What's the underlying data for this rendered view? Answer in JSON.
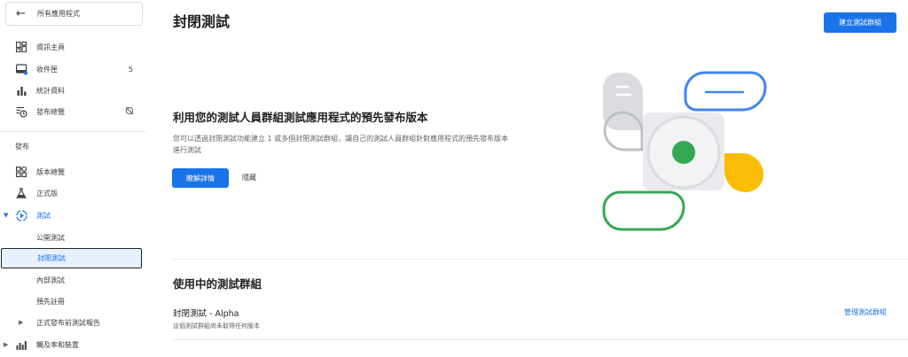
{
  "sidebar": {
    "back_label": "所有應用程式",
    "top_items": [
      {
        "label": "資訊主頁",
        "icon": "dashboard-icon"
      },
      {
        "label": "收件匣",
        "icon": "inbox-icon",
        "count": "5"
      },
      {
        "label": "統計資料",
        "icon": "bar-chart-icon"
      },
      {
        "label": "發布總覽",
        "icon": "publishing-overview-icon",
        "trail_icon": "sync-disabled-icon"
      }
    ],
    "section_label": "發布",
    "release_items": [
      {
        "label": "版本總覽",
        "icon": "release-overview-icon"
      },
      {
        "label": "正式版",
        "icon": "production-flask-icon"
      },
      {
        "label": "測試",
        "icon": "testing-play-icon",
        "active": true
      }
    ],
    "testing_sub_items": [
      {
        "label": "公開測試"
      },
      {
        "label": "封閉測試",
        "selected": true
      },
      {
        "label": "內部測試"
      },
      {
        "label": "預先註冊"
      }
    ],
    "extra_items": [
      {
        "label": "正式發布前測試報告"
      },
      {
        "label": "觸及率和裝置",
        "icon": "reach-devices-icon"
      }
    ]
  },
  "header": {
    "title": "封閉測試",
    "create_button": "建立測試群組"
  },
  "promo": {
    "heading": "利用您的測試人員群組測試應用程式的預先發布版本",
    "description": "您可以透過封閉測試功能建立 1 或多個封閉測試群組，讓自己的測試人員群組針對應用程式的預先發布版本進行測試",
    "learn_more": "瞭解詳情",
    "hide": "隱藏"
  },
  "tracks": {
    "heading": "使用中的測試群組",
    "items": [
      {
        "name": "封閉測試 - Alpha",
        "subtitle": "這個測試群組尚未取得任何版本",
        "manage": "管理測試群組"
      }
    ]
  },
  "colors": {
    "accent": "#1a73e8",
    "illus_blue": "#4285f4",
    "illus_green": "#34a853",
    "illus_yellow": "#fbbc04",
    "illus_gray": "#dadce0"
  }
}
